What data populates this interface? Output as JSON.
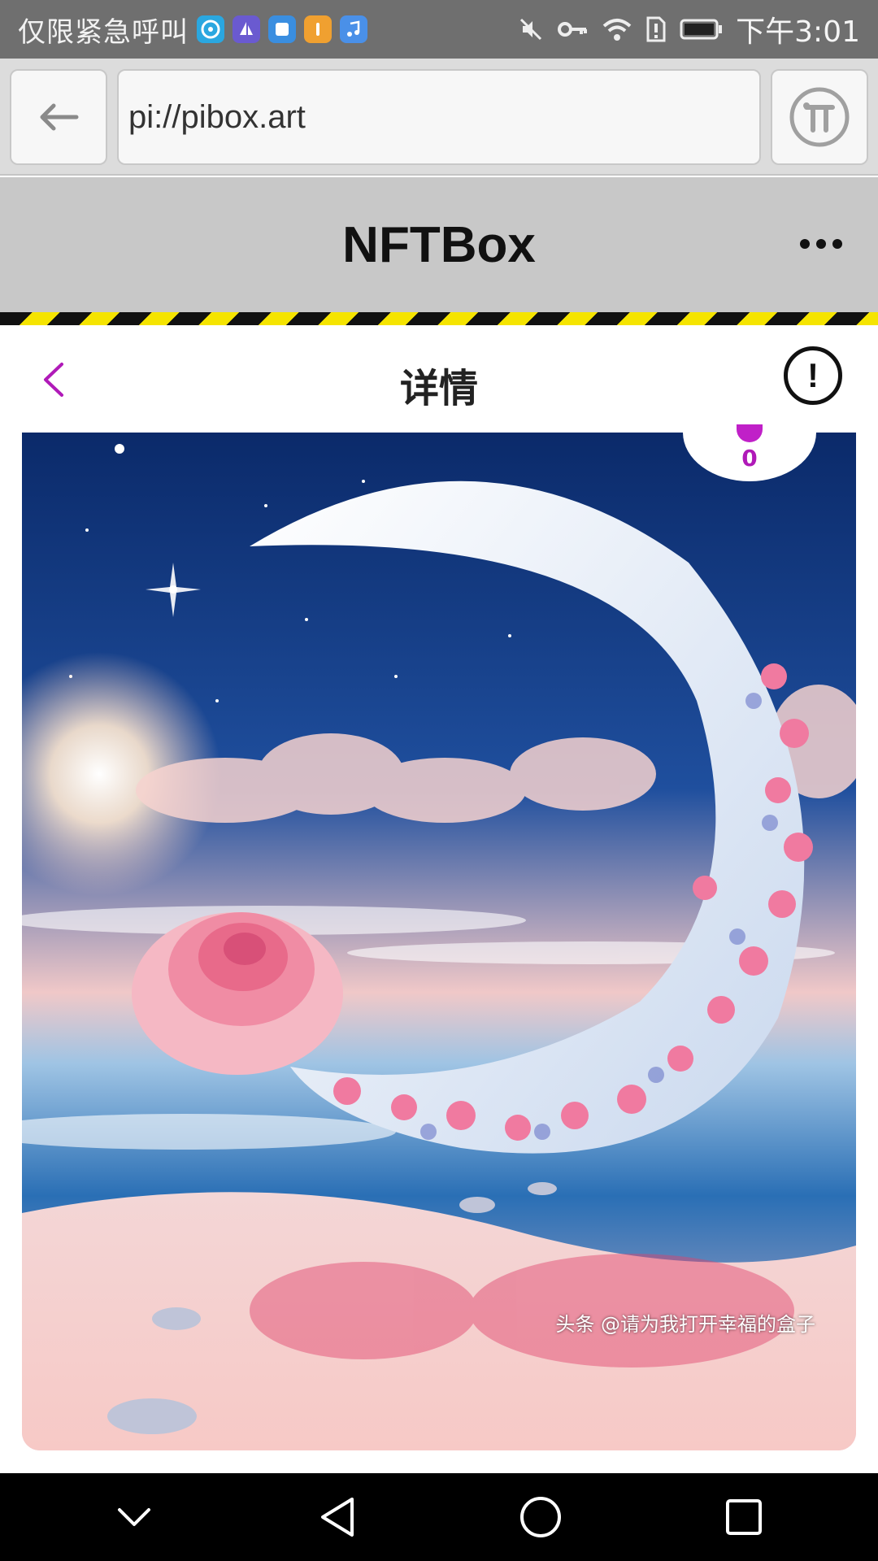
{
  "status_bar": {
    "carrier_text": "仅限紧急呼叫",
    "time": "下午3:01",
    "app_icons": [
      "pinwheel-icon",
      "sailboat-icon",
      "shield-app-icon",
      "orange-app-icon",
      "music-app-icon"
    ]
  },
  "browser": {
    "url": "pi://pibox.art"
  },
  "app": {
    "title": "NFTBox"
  },
  "detail": {
    "title": "详情",
    "report_symbol": "!"
  },
  "artwork": {
    "like_count": "0",
    "watermark": "头条 @请为我打开幸福的盒子"
  },
  "colors": {
    "accent_purple": "#b01ab8",
    "hazard_yellow": "#f5e400",
    "header_gray": "#c8c8c8"
  }
}
